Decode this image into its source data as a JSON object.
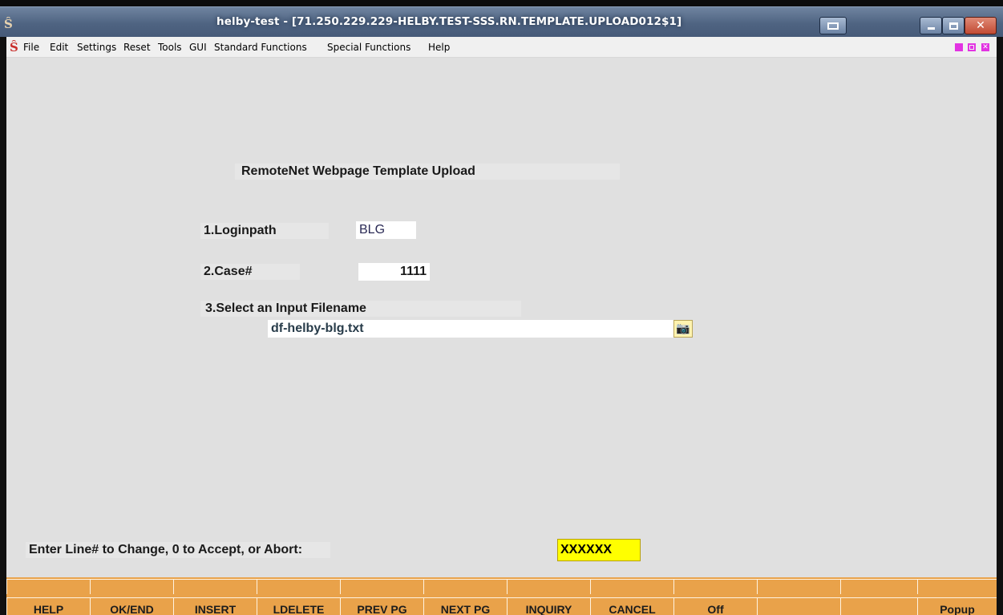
{
  "window": {
    "title": "helby-test - [71.250.229.229-HELBY.TEST-SSS.RN.TEMPLATE.UPLOAD012$1]",
    "buttons": {
      "minimize": "–",
      "maximize": "□",
      "close": "X"
    }
  },
  "menu": {
    "items": [
      "File",
      "Edit",
      "Settings",
      "Reset",
      "Tools",
      "GUI",
      "Standard Functions",
      "Special Functions",
      "Help"
    ]
  },
  "form": {
    "title": "RemoteNet Webpage Template Upload",
    "fields": [
      {
        "label": "1.Loginpath",
        "value": "BLG"
      },
      {
        "label": "2.Case#",
        "value": "1111"
      },
      {
        "label": "3.Select an Input Filename",
        "value": "df-helby-blg.txt"
      }
    ],
    "lookup_icon": "camera-icon"
  },
  "prompt": {
    "text": "Enter Line# to Change, 0 to Accept, or Abort:",
    "value": "XXXXXX"
  },
  "function_keys": [
    "HELP",
    "OK/END",
    "INSERT",
    "LDELETE",
    "PREV PG",
    "NEXT PG",
    "INQUIRY",
    "CANCEL",
    "Off",
    "",
    "",
    "Popup"
  ],
  "colors": {
    "titlebar": "#4f6482",
    "background": "#e0e0e0",
    "function_keys": "#e9a24a",
    "prompt_field": "#ffff00",
    "mdi_buttons": "#e233e2"
  }
}
